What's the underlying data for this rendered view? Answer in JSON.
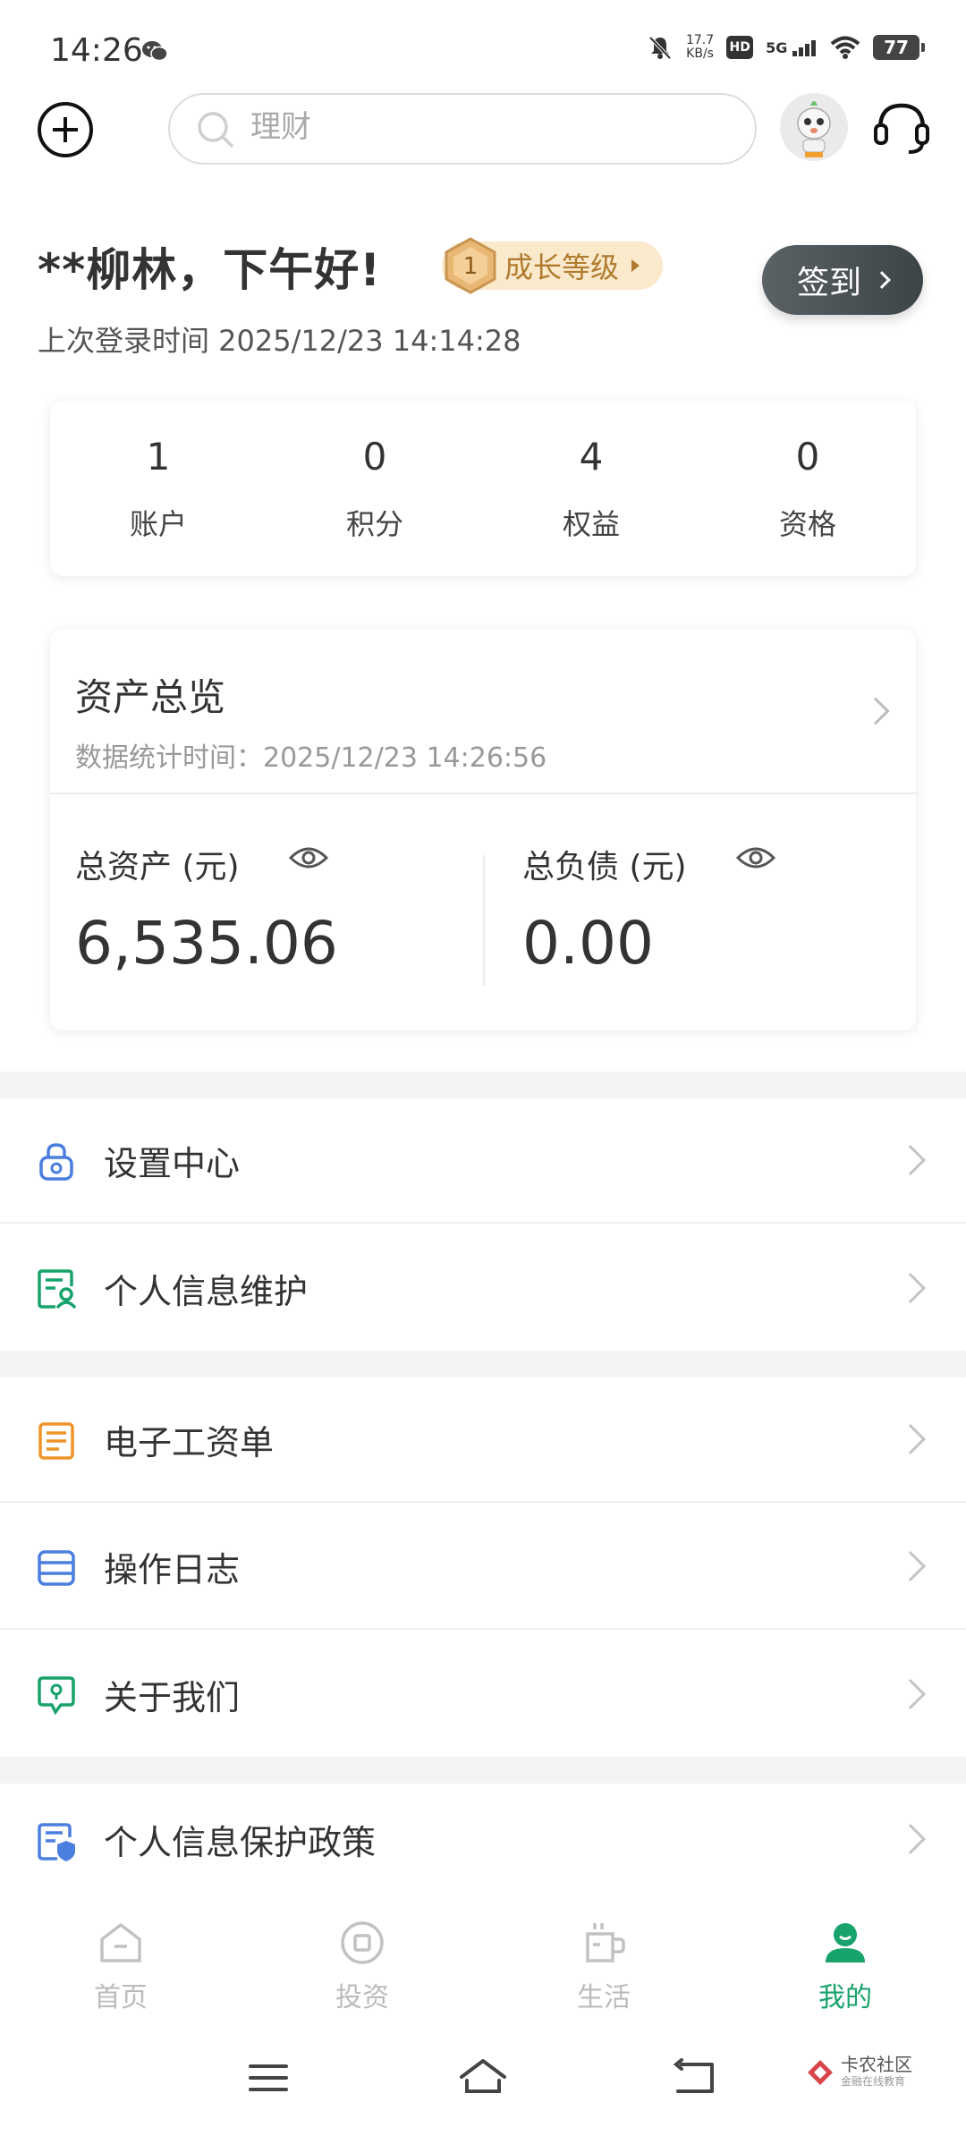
{
  "status_bar": {
    "time": "14:26",
    "net_speed_value": "17.7",
    "net_speed_unit": "KB/s",
    "hd": "HD",
    "network": "5G",
    "battery": "77"
  },
  "top_bar": {
    "search_placeholder": "理财"
  },
  "greeting": {
    "text": "**柳林，下午好!",
    "level_number": "1",
    "level_label": "成长等级",
    "checkin_label": "签到",
    "last_login": "上次登录时间  2025/12/23  14:14:28"
  },
  "stats": [
    {
      "value": "1",
      "label": "账户"
    },
    {
      "value": "0",
      "label": "积分"
    },
    {
      "value": "4",
      "label": "权益"
    },
    {
      "value": "0",
      "label": "资格"
    }
  ],
  "assets": {
    "title": "资产总览",
    "stat_time": "数据统计时间：2025/12/23 14:26:56",
    "total_assets_label": "总资产 (元)",
    "total_assets_value": "6,535.06",
    "total_liabilities_label": "总负债 (元)",
    "total_liabilities_value": "0.00"
  },
  "menu": {
    "settings": "设置中心",
    "personal_info": "个人信息维护",
    "payslip": "电子工资单",
    "operation_log": "操作日志",
    "about_us": "关于我们",
    "privacy_policy": "个人信息保护政策"
  },
  "bottom_nav": [
    {
      "label": "首页"
    },
    {
      "label": "投资"
    },
    {
      "label": "生活"
    },
    {
      "label": "我的"
    }
  ],
  "watermark": {
    "title": "卡农社区",
    "subtitle": "金融在线教育"
  },
  "colors": {
    "accent": "#17a36b",
    "level_bg": "#fbe9cc",
    "level_text": "#b07b2e",
    "checkin_bg": "#4a5256"
  }
}
